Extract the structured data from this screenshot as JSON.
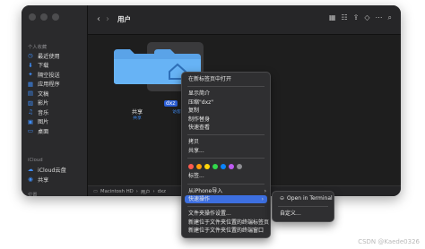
{
  "toolbar": {
    "back": "‹",
    "forward": "›",
    "title": "用户"
  },
  "sidebar": {
    "personal_header": "个人收藏",
    "items": [
      {
        "icon": "◷",
        "label": "最近使用"
      },
      {
        "icon": "⬇",
        "label": "下载"
      },
      {
        "icon": "✦",
        "label": "隔空投送"
      },
      {
        "icon": "▦",
        "label": "应用程序"
      },
      {
        "icon": "▤",
        "label": "文稿"
      },
      {
        "icon": "▨",
        "label": "影片"
      },
      {
        "icon": "♫",
        "label": "音乐"
      },
      {
        "icon": "▣",
        "label": "图片"
      },
      {
        "icon": "▭",
        "label": "桌面"
      }
    ],
    "icloud_header": "iCloud",
    "icloud_items": [
      {
        "icon": "☁",
        "label": "iCloud云盘"
      },
      {
        "icon": "◉",
        "label": "共享"
      }
    ],
    "location_header": "位置"
  },
  "files": [
    {
      "name": "共享",
      "sub": "共享"
    },
    {
      "name": "dxz",
      "sub": "访客"
    }
  ],
  "pathbar": {
    "parts": [
      "Macintosh HD",
      "用户",
      "dxz"
    ]
  },
  "context_menu": {
    "group1": [
      "在新标签页中打开"
    ],
    "group2": [
      "显示简介",
      "压缩\"dxz\"",
      "复制",
      "制作替身",
      "快速查看"
    ],
    "group3": [
      "拷贝",
      "共享..."
    ],
    "tag_colors": [
      "#ff5b4f",
      "#ff9f0a",
      "#ffd60a",
      "#32d74b",
      "#0a84ff",
      "#bf5af2",
      "#8e8e93"
    ],
    "group4": [
      "标签..."
    ],
    "group5": [
      {
        "label": "从iPhone导入",
        "submenu": true
      },
      {
        "label": "快速操作",
        "submenu": true,
        "highlighted": true
      }
    ],
    "group6": [
      "文件夹操作设置...",
      "新建位于文件夹位置的终端标签页",
      "新建位于文件夹位置的终端窗口"
    ]
  },
  "submenu": {
    "items": [
      "Open in Terminal",
      "自定义..."
    ]
  },
  "watermark": "CSDN @Kaede0326"
}
